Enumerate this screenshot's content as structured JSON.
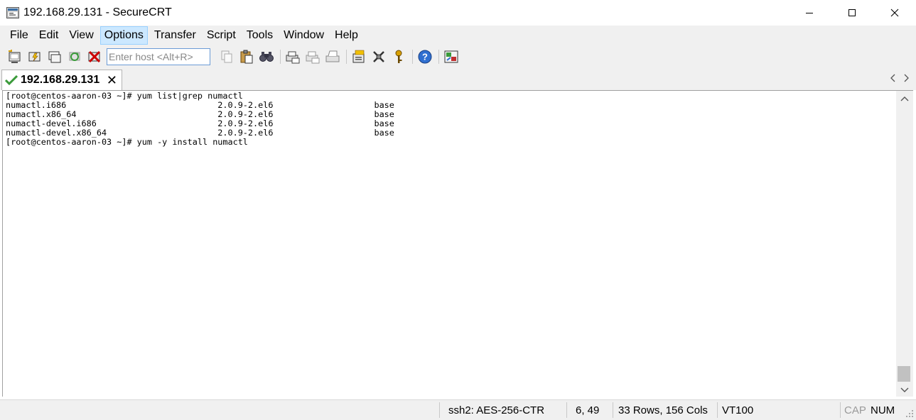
{
  "window": {
    "title": "192.168.29.131 - SecureCRT"
  },
  "menu": {
    "items": [
      "File",
      "Edit",
      "View",
      "Options",
      "Transfer",
      "Script",
      "Tools",
      "Window",
      "Help"
    ],
    "active_index": 3
  },
  "toolbar": {
    "host_placeholder": "Enter host <Alt+R>",
    "icons_left": [
      "connect-icon",
      "quick-connect-icon",
      "connect-in-tab-icon",
      "reconnect-icon",
      "disconnect-icon"
    ],
    "icons_right": [
      "copy-icon",
      "paste-icon",
      "find-icon",
      "print-screen-icon",
      "print-selection-icon",
      "print-icon",
      "session-options-icon",
      "global-options-icon",
      "keymap-icon",
      "help-icon",
      "sftp-icon"
    ]
  },
  "tab": {
    "label": "192.168.29.131",
    "status_icon": "checkmark-icon",
    "close_glyph": "✕"
  },
  "terminal": {
    "lines": [
      "[root@centos-aaron-03 ~]# yum list|grep numactl",
      "numactl.i686                              2.0.9-2.el6                    base",
      "numactl.x86_64                            2.0.9-2.el6                    base",
      "numactl-devel.i686                        2.0.9-2.el6                    base",
      "numactl-devel.x86_64                      2.0.9-2.el6                    base",
      "[root@centos-aaron-03 ~]# yum -y install numactl"
    ],
    "scroll_position": 0.95
  },
  "status": {
    "encryption": "ssh2: AES-256-CTR",
    "cursor": "6,  49",
    "size": "33 Rows, 156 Cols",
    "emulation": "VT100",
    "cap": "CAP",
    "num": "NUM"
  },
  "colors": {
    "menu_active_bg": "#cce8ff",
    "chrome_bg": "#f0f0f0",
    "check_green": "#3a9a3a"
  }
}
